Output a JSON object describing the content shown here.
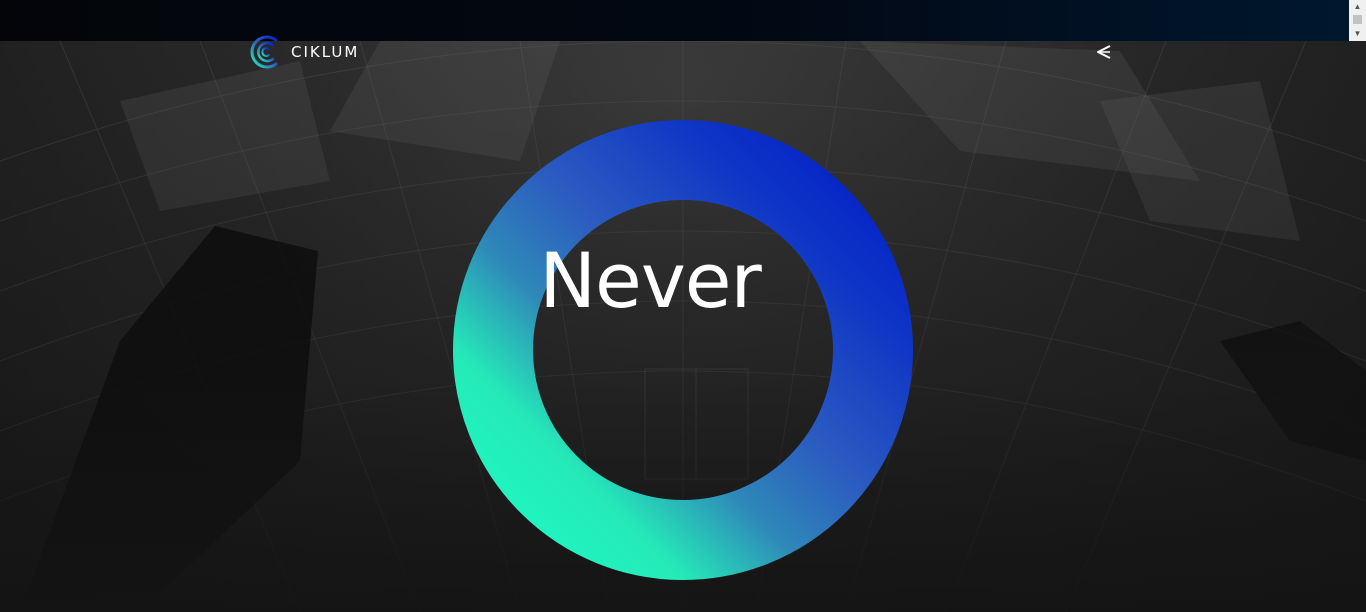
{
  "header": {
    "logo_text": "CIKLUM",
    "logo_icon": "ciklum-c-logo-icon",
    "share_icon": "share-icon"
  },
  "hero": {
    "word": "Never"
  },
  "colors": {
    "ring_gradient_start": "#1cf5c0",
    "ring_gradient_mid": "#2e62bd",
    "ring_gradient_end": "#0322c8",
    "top_strip": "#020813",
    "background": "#141414"
  }
}
